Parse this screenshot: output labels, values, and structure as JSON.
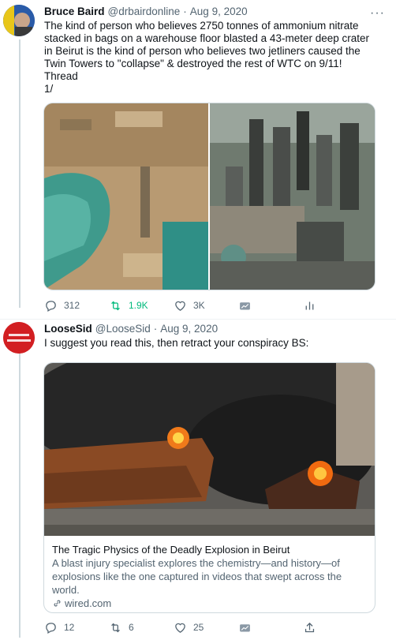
{
  "tweets": [
    {
      "name": "Bruce Baird",
      "handle": "@drbairdonline",
      "separator": "·",
      "date": "Aug 9, 2020",
      "text": "The kind of person who believes 2750 tonnes of ammonium nitrate stacked in bags on a warehouse floor blasted a 43-meter deep crater in Beirut is the kind of person who believes two jetliners caused the Twin Towers to \"collapse\" & destroyed the rest of WTC on 9/11!\nThread\n1/",
      "stats": {
        "replies": "312",
        "retweets": "1.9K",
        "likes": "3K"
      }
    },
    {
      "name": "LooseSid",
      "handle": "@LooseSid",
      "separator": "·",
      "date": "Aug 9, 2020",
      "text": "I suggest you read this, then retract your conspiracy BS:",
      "card": {
        "title": "The Tragic Physics of the Deadly Explosion in Beirut",
        "description": "A blast injury specialist explores the chemistry—and history—of explosions like the one captured in videos that swept across the world.",
        "domain": "wired.com"
      },
      "stats": {
        "replies": "12",
        "retweets": "6",
        "likes": "25"
      }
    }
  ],
  "icons": [
    "reply-icon",
    "retweet-icon",
    "like-icon",
    "share-icon",
    "analytics-icon",
    "link-icon",
    "more-icon"
  ],
  "colors": {
    "retweet_active": "#00ba7c",
    "text": "#0f1419",
    "muted": "#536471",
    "line": "#cfd9de"
  }
}
